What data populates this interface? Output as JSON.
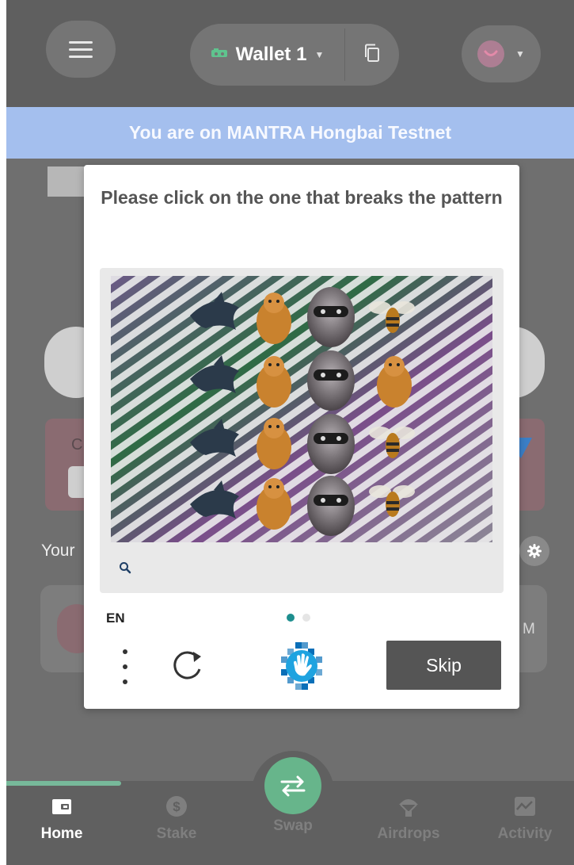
{
  "header": {
    "wallet_name": "Wallet 1"
  },
  "banner": {
    "text": "You are on MANTRA Hongbai Testnet"
  },
  "background": {
    "partial_left_card_letter": "C",
    "your_label_partial": "Your",
    "row_value_partial": "M"
  },
  "captcha": {
    "prompt": "Please click on the one that breaks the pattern",
    "language": "EN",
    "skip_label": "Skip",
    "page_indicator": {
      "current": 1,
      "total": 2
    },
    "grid": {
      "rows": 4,
      "columns": [
        "dolphin",
        "quokka",
        "raccoon",
        "bee"
      ],
      "odd_cell": {
        "row": 2,
        "column": 4,
        "animal": "quokka"
      }
    }
  },
  "nav": {
    "items": [
      {
        "label": "Home",
        "icon": "wallet-icon",
        "active": true
      },
      {
        "label": "Stake",
        "icon": "dollar-icon",
        "active": false
      },
      {
        "label": "Swap",
        "icon": "swap-icon",
        "active": false
      },
      {
        "label": "Airdrops",
        "icon": "parachute-icon",
        "active": false
      },
      {
        "label": "Activity",
        "icon": "chart-icon",
        "active": false
      }
    ]
  },
  "colors": {
    "accent_green": "#67b58b",
    "banner_blue": "#a4bfee",
    "captcha_teal": "#1d8e8e",
    "skip_button": "#555555"
  }
}
